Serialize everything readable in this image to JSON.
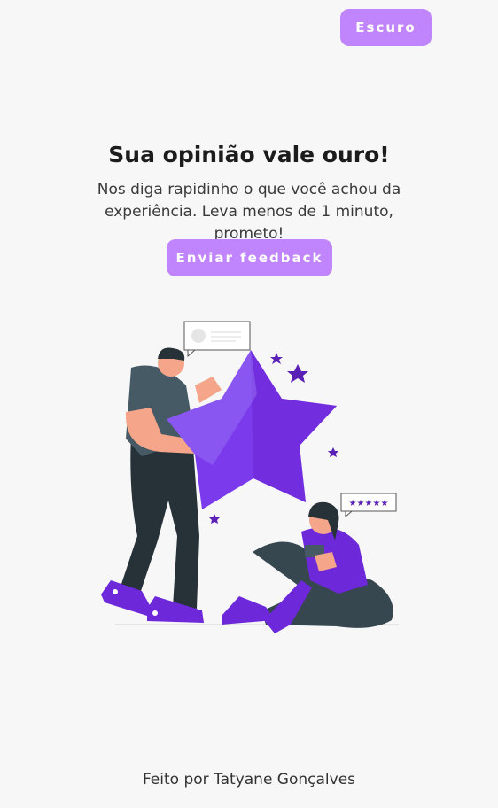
{
  "header": {
    "theme_toggle_label": "Escuro"
  },
  "main": {
    "title": "Sua opinião vale ouro!",
    "subtitle": "Nos diga rapidinho o que você achou da experiência. Leva menos de 1 minuto, prometo!",
    "feedback_button_label": "Enviar feedback"
  },
  "illustration": {
    "name": "feedback-star-illustration",
    "accent_color": "#6d28d9",
    "star_color": "#7c3aed"
  },
  "footer": {
    "credit": "Feito por Tatyane Gonçalves"
  },
  "colors": {
    "button": "#c084fc",
    "background": "#f7f7f7",
    "text": "#222222"
  }
}
